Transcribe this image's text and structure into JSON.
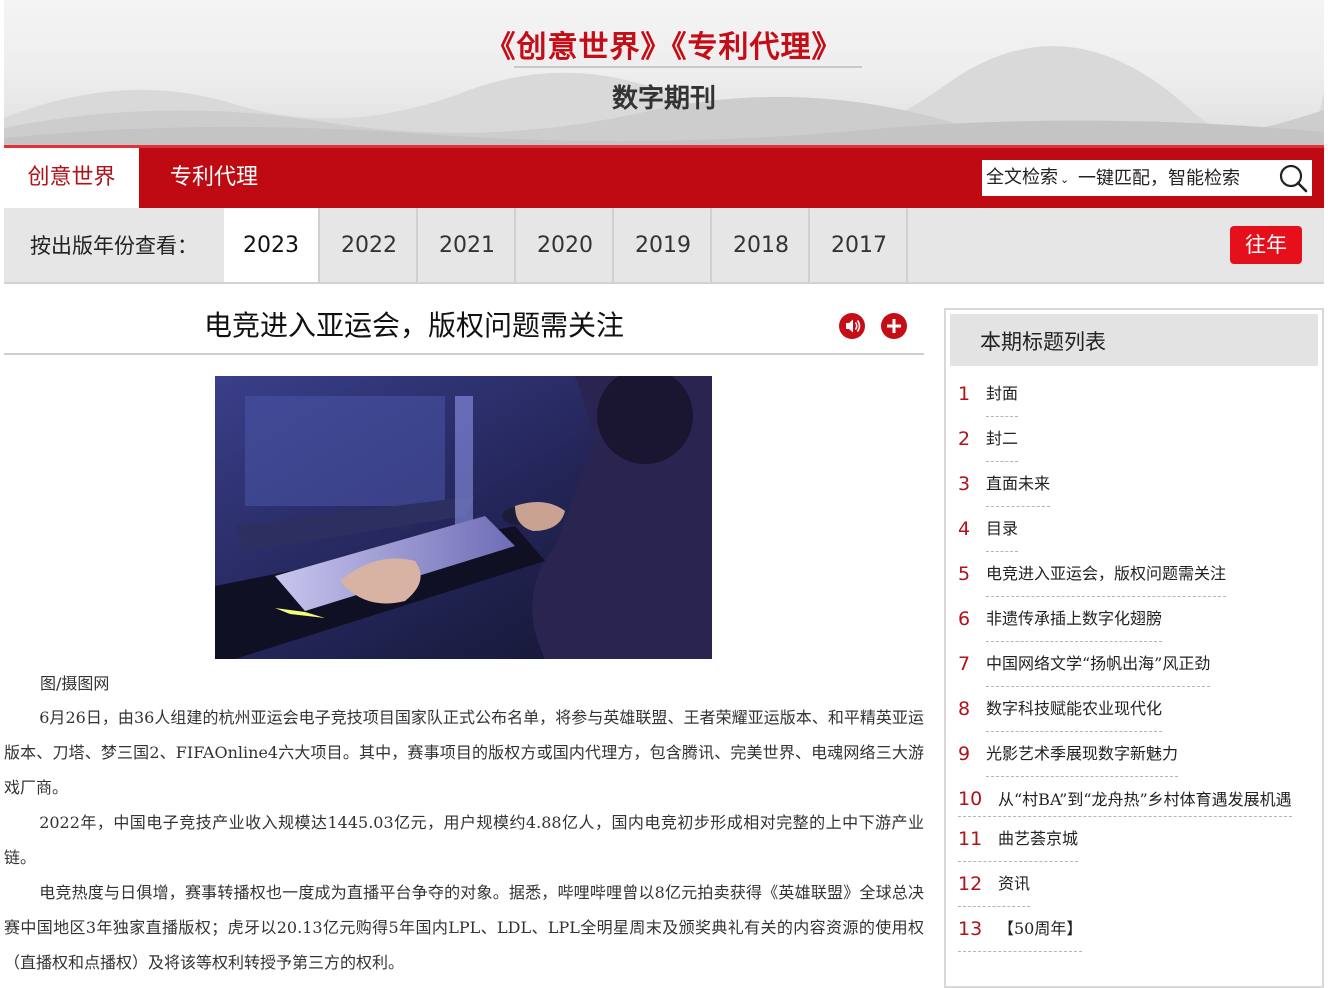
{
  "header": {
    "title": "《创意世界》《专利代理》",
    "subtitle": "数字期刊"
  },
  "nav": {
    "tabs": [
      "创意世界",
      "专利代理"
    ],
    "active": "创意世界",
    "search": {
      "scope": "全文检索",
      "placeholder": "一键匹配，智能检索",
      "icon": "search-icon"
    }
  },
  "yearbar": {
    "label": "按出版年份查看：",
    "years": [
      "2023",
      "2022",
      "2021",
      "2020",
      "2019",
      "2018",
      "2017"
    ],
    "active_year": "2023",
    "past_button": "往年"
  },
  "article": {
    "title": "电竞进入亚运会，版权问题需关注",
    "audio_icon": "speaker-icon",
    "add_icon": "plus-icon",
    "image_caption": "图/摄图网",
    "paragraphs": [
      "6月26日，由36人组建的杭州亚运会电子竞技项目国家队正式公布名单，将参与英雄联盟、王者荣耀亚运版本、和平精英亚运版本、刀塔、梦三国2、FIFAOnline4六大项目。其中，赛事项目的版权方或国内代理方，包含腾讯、完美世界、电魂网络三大游戏厂商。",
      "2022年，中国电子竞技产业收入规模达1445.03亿元，用户规模约4.88亿人，国内电竞初步形成相对完整的上中下游产业链。",
      "电竞热度与日俱增，赛事转播权也一度成为直播平台争夺的对象。据悉，哔哩哔哩曾以8亿元拍卖获得《英雄联盟》全球总决赛中国地区3年独家直播版权；虎牙以20.13亿元购得5年国内LPL、LDL、LPL全明星周末及颁奖典礼有关的内容资源的使用权（直播权和点播权）及将该等权利转授予第三方的权利。"
    ]
  },
  "sidebar": {
    "title": "本期标题列表",
    "items": [
      {
        "num": "1",
        "label": "封面"
      },
      {
        "num": "2",
        "label": "封二"
      },
      {
        "num": "3",
        "label": "直面未来"
      },
      {
        "num": "4",
        "label": "目录"
      },
      {
        "num": "5",
        "label": "电竞进入亚运会，版权问题需关注"
      },
      {
        "num": "6",
        "label": "非遗传承插上数字化翅膀"
      },
      {
        "num": "7",
        "label": "中国网络文学“扬帆出海”风正劲"
      },
      {
        "num": "8",
        "label": "数字科技赋能农业现代化"
      },
      {
        "num": "9",
        "label": "光影艺术季展现数字新魅力"
      },
      {
        "num": "10",
        "label": "从“村BA”到“龙舟热”乡村体育遇发展机遇"
      },
      {
        "num": "11",
        "label": "曲艺荟京城"
      },
      {
        "num": "12",
        "label": "资讯"
      },
      {
        "num": "13",
        "label": "【50周年】"
      }
    ]
  },
  "colors": {
    "brand_red": "#bf0a13",
    "button_red": "#e5101b",
    "number_red": "#b0121a"
  }
}
